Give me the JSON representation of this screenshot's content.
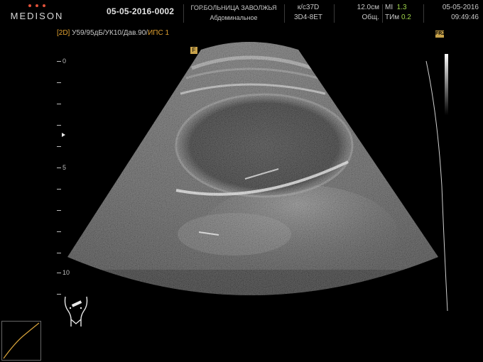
{
  "header": {
    "logo_text": "MEDISON",
    "patient_id": "05-05-2016-0002",
    "hospital": "ГОР.БОЛЬНИЦА ЗАВОЛЖЬЯ",
    "preset": "Абдоминальное",
    "probe_freq": "к/с37D",
    "probe_name": "3D4-8ET",
    "depth": "12.0см",
    "depth_mode": "Общ.",
    "mi_label": "MI",
    "mi_value": "1.3",
    "tim_label": "TИм",
    "tim_value": "0.2",
    "date": "05-05-2016",
    "time": "09:49:46"
  },
  "params": {
    "mode": "[2D]",
    "text": " У59/95дБ/УК10/Дав.90/",
    "extra": "ИПС 1"
  },
  "freeze_icon": "FRZ",
  "focus_marker_icon": "F",
  "scale": {
    "labels": [
      "0",
      "5",
      "10"
    ]
  },
  "colors": {
    "accent": "#e0a030",
    "mi_green": "#9fd44a",
    "logo_dots": "#e0523a",
    "background": "#000000"
  },
  "icons": {
    "body_marker": "body-marker-icon",
    "gamma_curve": "gamma-curve-icon",
    "freeze": "freeze-icon",
    "focus": "focus-marker-icon"
  }
}
